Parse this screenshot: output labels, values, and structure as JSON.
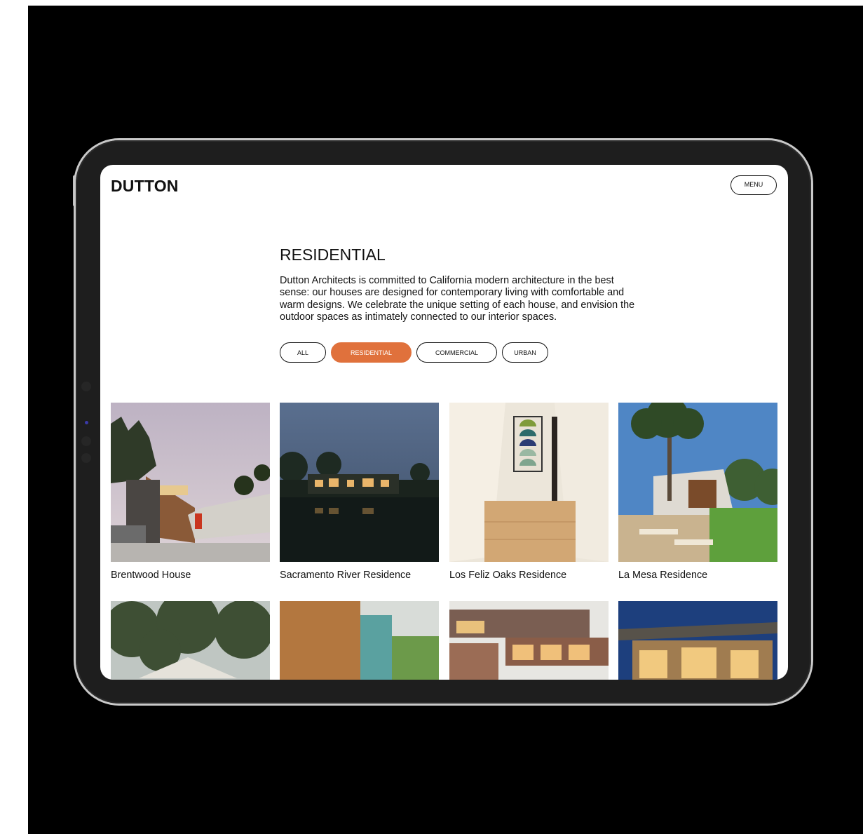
{
  "site": {
    "logo": "DUTTON",
    "menu_label": "MENU"
  },
  "page": {
    "heading": "RESIDENTIAL",
    "intro": "Dutton Architects is committed to California modern architecture in the best sense: our houses are designed for contemporary living with comfortable and warm designs. We celebrate the unique setting of each house, and envision the outdoor spaces as intimately connected to our interior spaces."
  },
  "filters": [
    {
      "label": "ALL",
      "active": false
    },
    {
      "label": "RESIDENTIAL",
      "active": true
    },
    {
      "label": "COMMERCIAL",
      "active": false
    },
    {
      "label": "URBAN",
      "active": false
    }
  ],
  "projects": [
    {
      "title": "Brentwood House"
    },
    {
      "title": "Sacramento River Residence"
    },
    {
      "title": "Los Feliz Oaks Residence"
    },
    {
      "title": "La Mesa Residence"
    }
  ],
  "colors": {
    "accent": "#e0713c",
    "text": "#111111",
    "background": "#ffffff",
    "device": "#1e1e1e"
  }
}
